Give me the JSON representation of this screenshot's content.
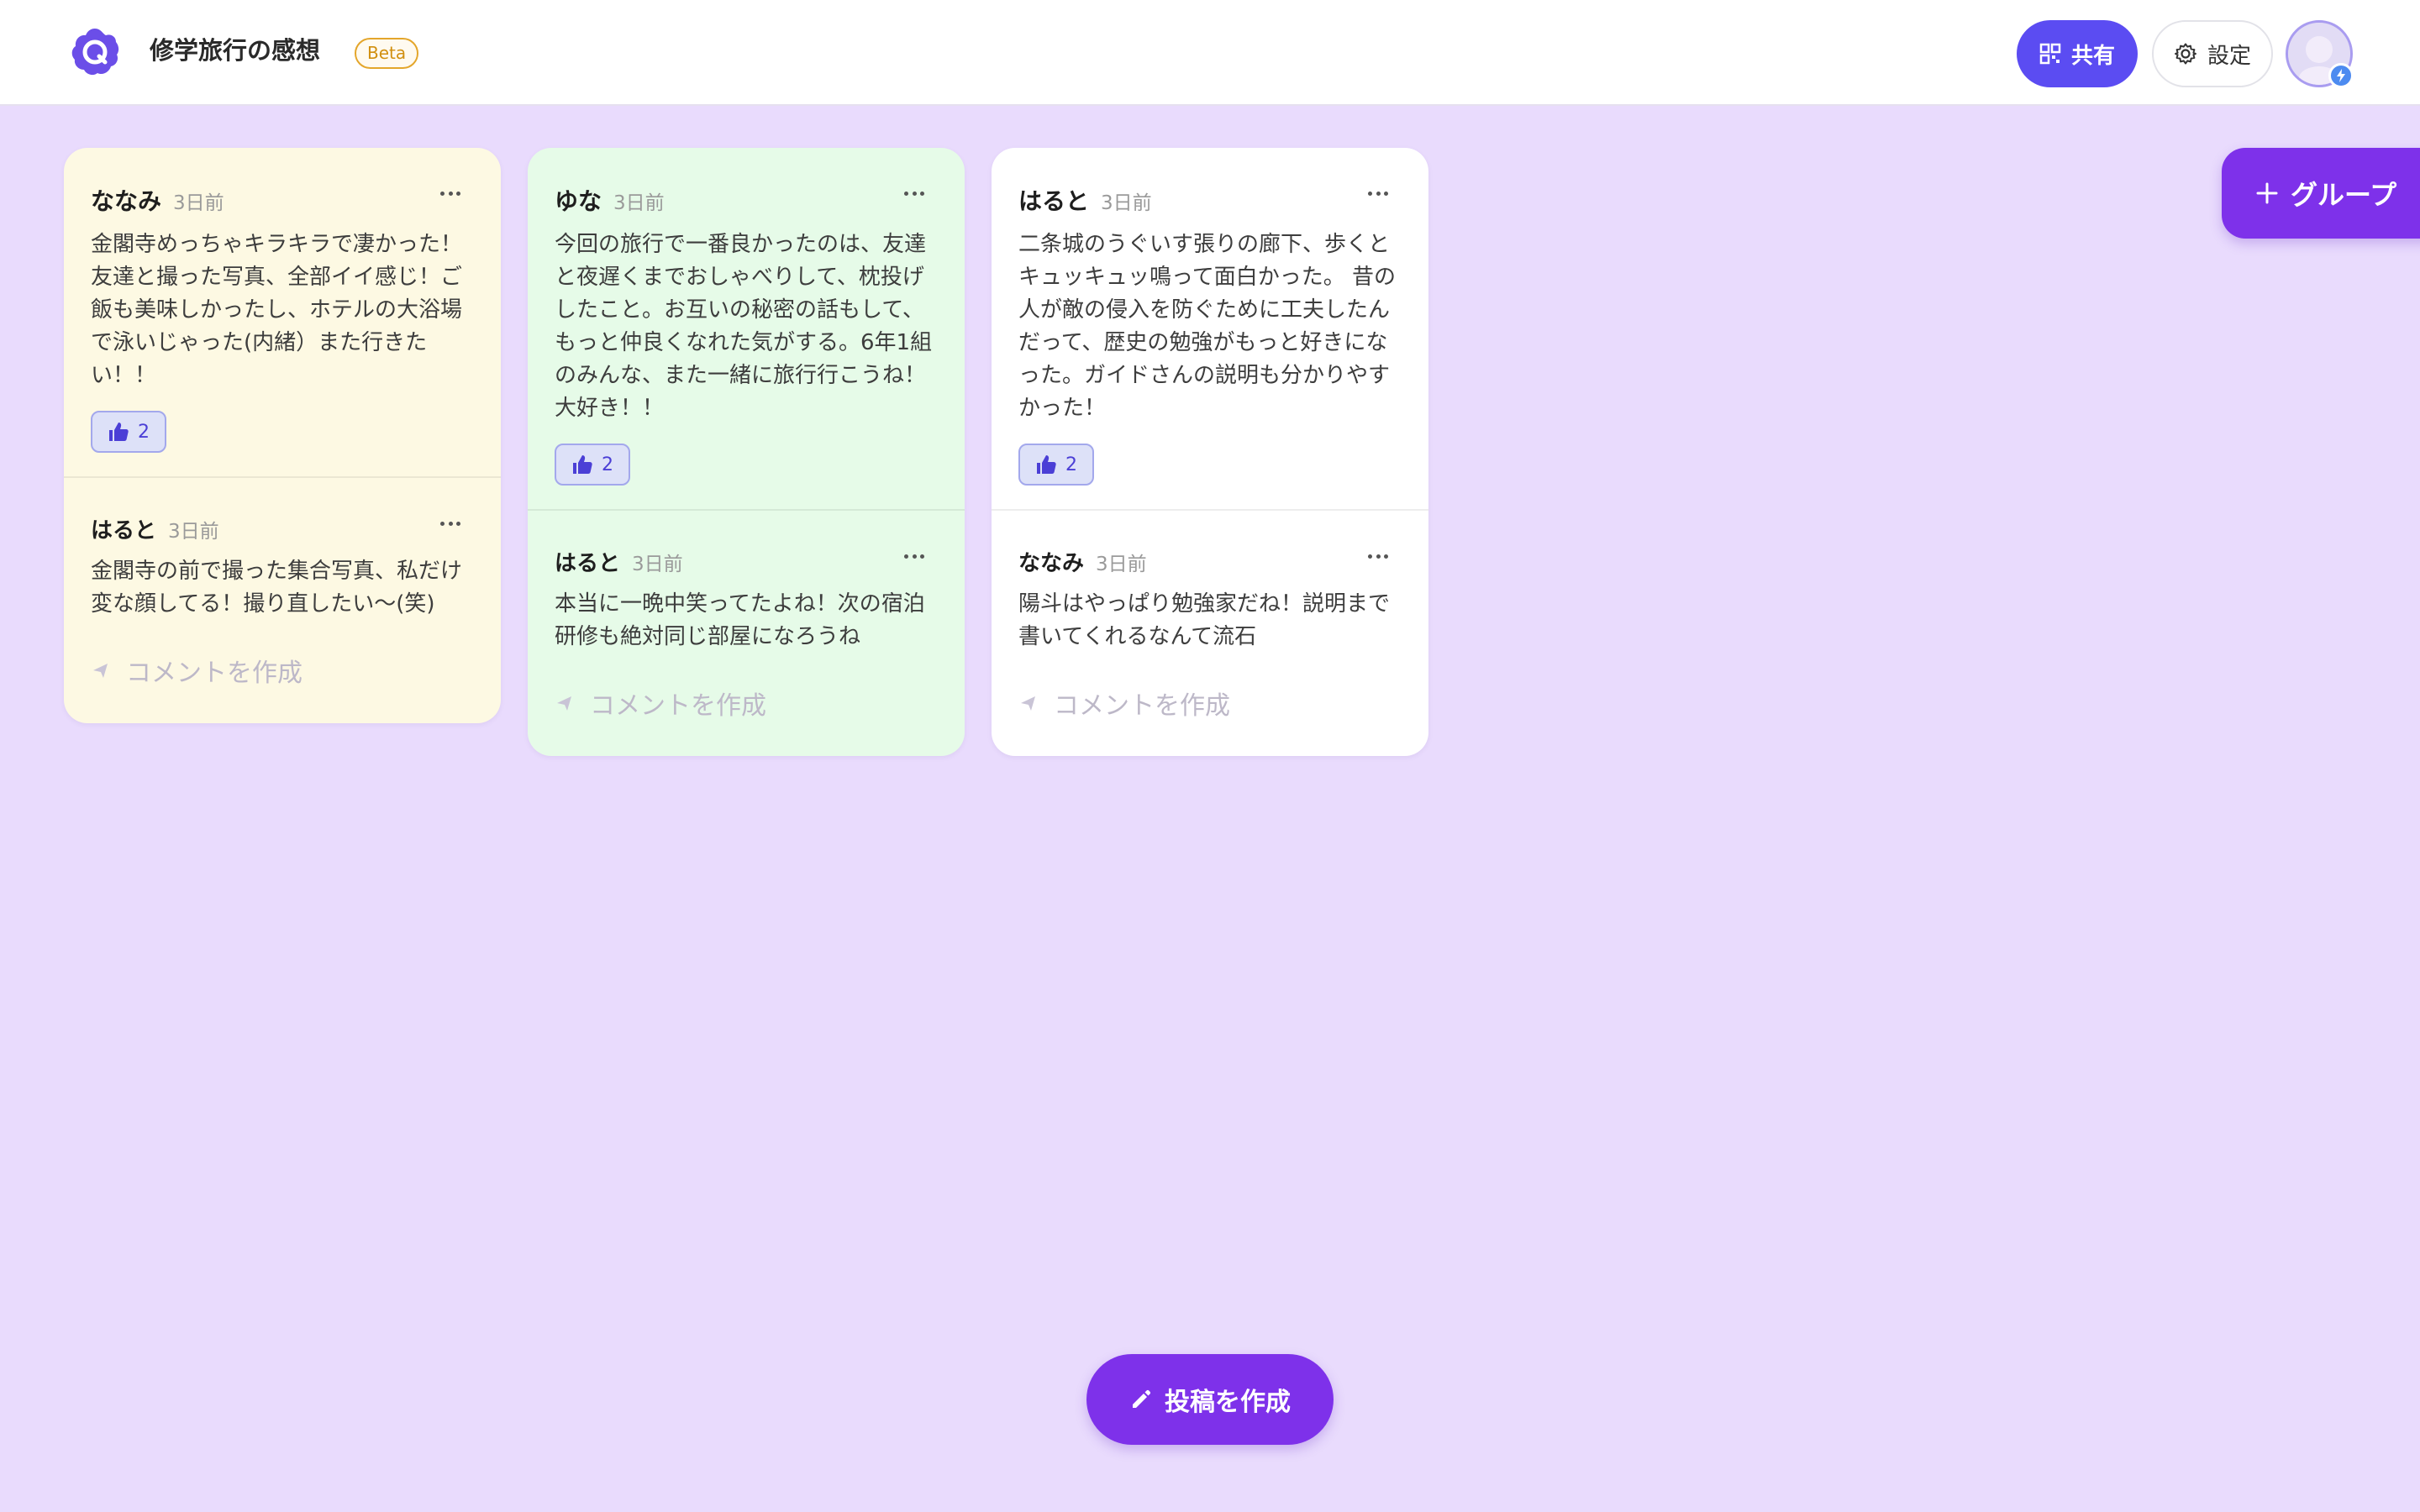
{
  "header": {
    "title": "修学旅行の感想",
    "beta": "Beta",
    "share_label": "共有",
    "settings_label": "設定"
  },
  "group_button": "グループ",
  "compose_button": "投稿を作成",
  "comment_placeholder": "コメントを作成",
  "colors": {
    "background": "#e9dbfd",
    "accent": "#7e31ea",
    "share": "#5b4cf2",
    "card_yellow": "#fdf9e3",
    "card_green": "#e6fbe8",
    "card_white": "#ffffff"
  },
  "cards": [
    {
      "author": "ななみ",
      "time": "3日前",
      "body": "金閣寺めっちゃキラキラで凄かった！友達と撮った写真、全部イイ感じ！ご飯も美味しかったし、ホテルの大浴場で泳いじゃった(内緒）また行きたい！！",
      "likes": "2",
      "comment": {
        "author": "はると",
        "time": "3日前",
        "body": "金閣寺の前で撮った集合写真、私だけ変な顔してる！撮り直したい〜(笑)"
      }
    },
    {
      "author": "ゆな",
      "time": "3日前",
      "body": "今回の旅行で一番良かったのは、友達と夜遅くまでおしゃべりして、枕投げしたこと。お互いの秘密の話もして、もっと仲良くなれた気がする。6年1組のみんな、また一緒に旅行行こうね！大好き！！",
      "likes": "2",
      "comment": {
        "author": "はると",
        "time": "3日前",
        "body": "本当に一晩中笑ってたよね！次の宿泊研修も絶対同じ部屋になろうね"
      }
    },
    {
      "author": "はると",
      "time": "3日前",
      "body": "二条城のうぐいす張りの廊下、歩くとキュッキュッ鳴って面白かった。 昔の人が敵の侵入を防ぐために工夫したんだって、歴史の勉強がもっと好きになった。ガイドさんの説明も分かりやすかった！",
      "likes": "2",
      "comment": {
        "author": "ななみ",
        "time": "3日前",
        "body": "陽斗はやっぱり勉強家だね！説明まで書いてくれるなんて流石"
      }
    }
  ]
}
